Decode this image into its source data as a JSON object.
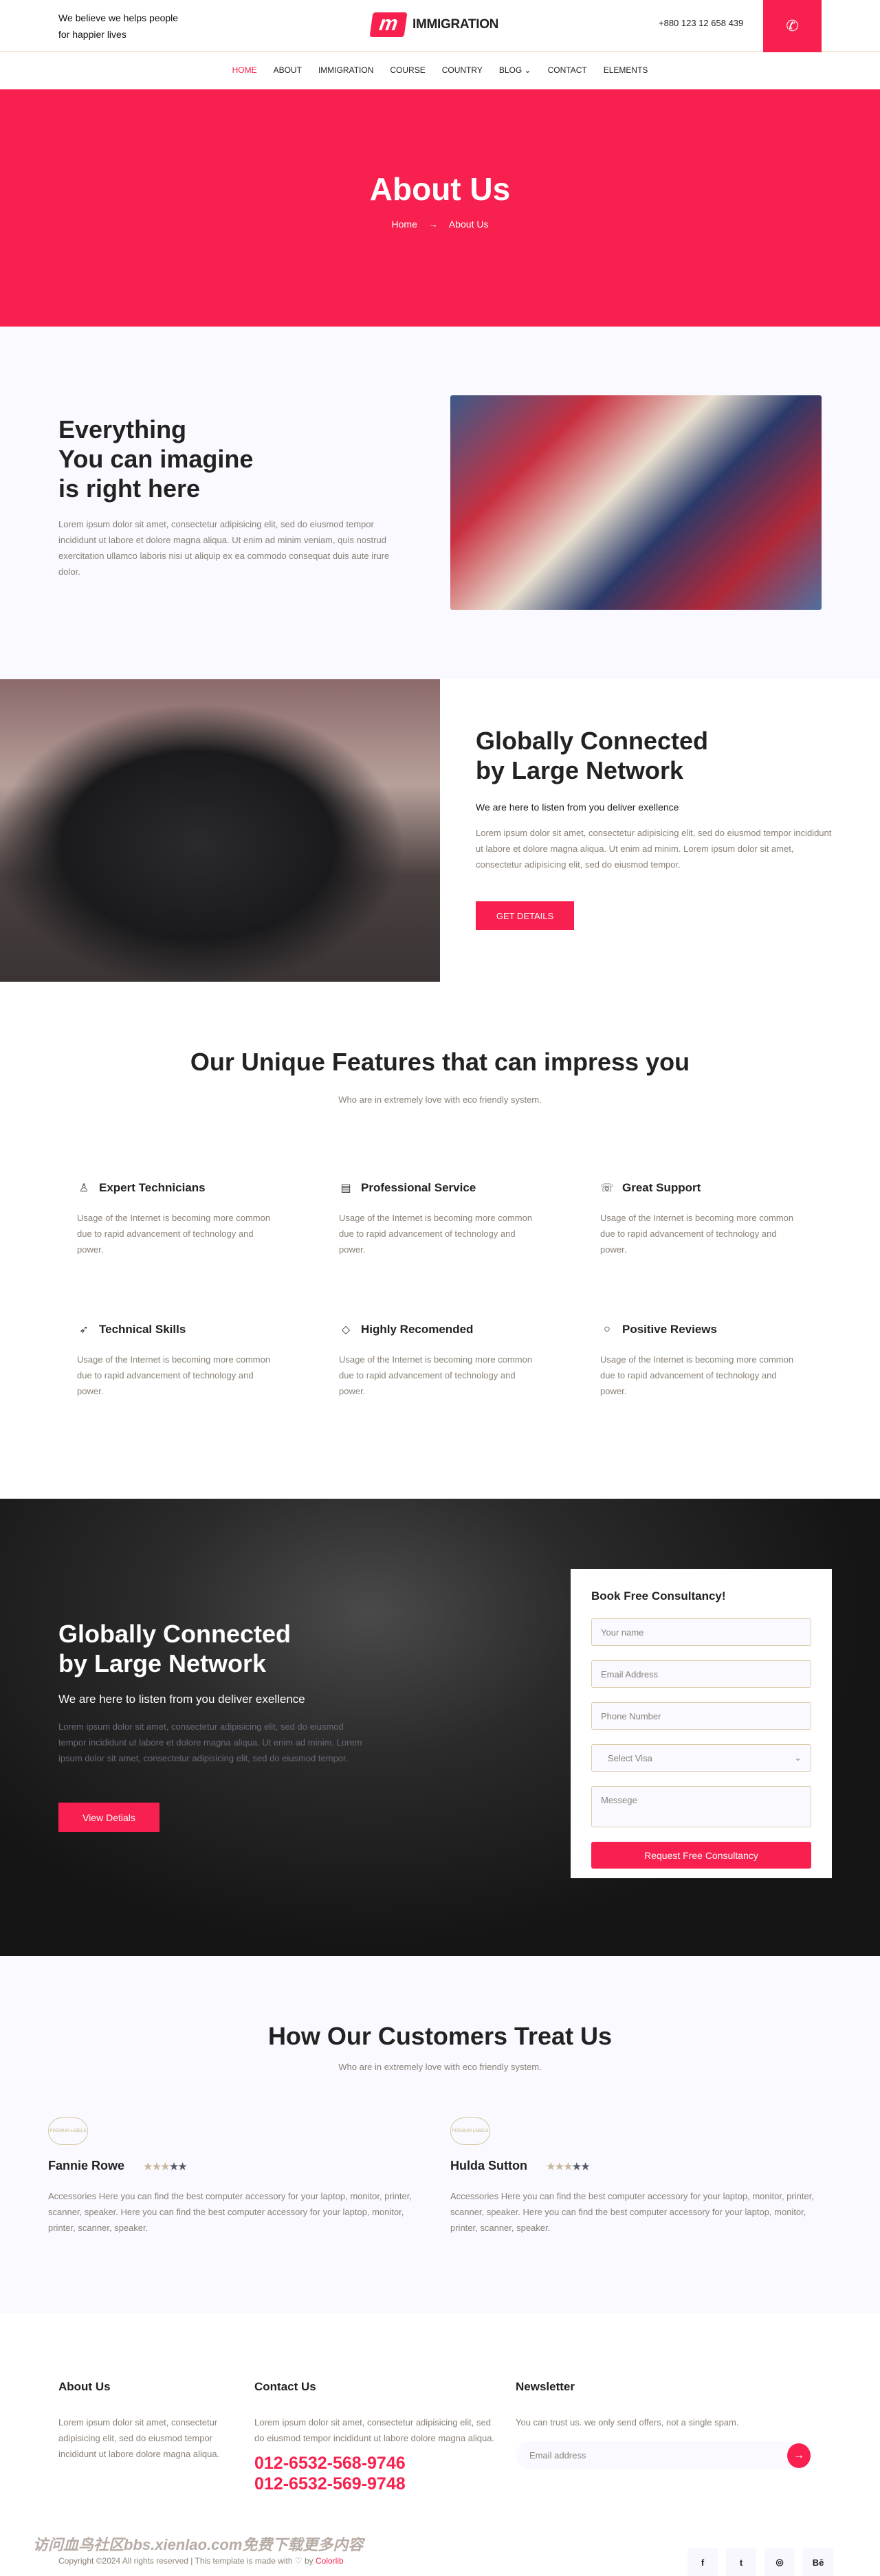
{
  "colors": {
    "accent": "#f8204e",
    "light_bg": "#f9f9ff",
    "dark_bg": "#141414"
  },
  "header": {
    "tagline_1": "We believe we helps people",
    "tagline_2": "for happier lives",
    "logo_mark": "m",
    "logo_text": "IMMIGRATION",
    "phone": "+880 123 12 658 439",
    "phone_icon": "phone-icon"
  },
  "nav": {
    "items": [
      {
        "label": "HOME",
        "active": true
      },
      {
        "label": "ABOUT"
      },
      {
        "label": "IMMIGRATION"
      },
      {
        "label": "COURSE"
      },
      {
        "label": "COUNTRY"
      },
      {
        "label": "BLOG",
        "dropdown": true
      },
      {
        "label": "CONTACT"
      },
      {
        "label": "ELEMENTS"
      }
    ],
    "dropdown_glyph": "⌄"
  },
  "hero": {
    "title": "About Us",
    "breadcrumb_home": "Home",
    "breadcrumb_arrow": "→",
    "breadcrumb_current": "About Us"
  },
  "intro": {
    "line1": "Everything",
    "line2": "You can imagine",
    "line3": "is right here",
    "text": "Lorem ipsum dolor sit amet, consectetur adipisicing elit, sed do eiusmod tempor incididunt ut labore et dolore magna aliqua. Ut enim ad minim veniam, quis nostrud exercitation ullamco laboris nisi ut aliquip ex ea commodo consequat duis aute irure dolor."
  },
  "network": {
    "line1": "Globally Connected",
    "line2": "by Large Network",
    "subtitle": "We are here to listen from you deliver exellence",
    "text": "Lorem ipsum dolor sit amet, consectetur adipisicing elit, sed do eiusmod tempor incididunt ut labore et dolore magna aliqua. Ut enim ad minim. Lorem ipsum dolor sit amet, consectetur adipisicing elit, sed do eiusmod tempor.",
    "button": "GET DETAILS"
  },
  "features": {
    "title": "Our Unique Features that can impress you",
    "subtitle": "Who are in extremely love with eco friendly system.",
    "items": [
      {
        "icon": "user-icon",
        "glyph": "♙",
        "title": "Expert Technicians",
        "text": "Usage of the Internet is becoming more common due to rapid advancement of technology and power."
      },
      {
        "icon": "license-icon",
        "glyph": "▤",
        "title": "Professional Service",
        "text": "Usage of the Internet is becoming more common due to rapid advancement of technology and power."
      },
      {
        "icon": "telephone-icon",
        "glyph": "☏",
        "title": "Great Support",
        "text": "Usage of the Internet is becoming more common due to rapid advancement of technology and power."
      },
      {
        "icon": "rocket-icon",
        "glyph": "➶",
        "title": "Technical Skills",
        "text": "Usage of the Internet is becoming more common due to rapid advancement of technology and power."
      },
      {
        "icon": "diamond-icon",
        "glyph": "◇",
        "title": "Highly Recomended",
        "text": "Usage of the Internet is becoming more common due to rapid advancement of technology and power."
      },
      {
        "icon": "bubble-icon",
        "glyph": "○",
        "title": "Positive Reviews",
        "text": "Usage of the Internet is becoming more common due to rapid advancement of technology and power."
      }
    ]
  },
  "consult": {
    "line1": "Globally Connected",
    "line2": "by Large Network",
    "subtitle": "We are here to listen from you deliver exellence",
    "text": "Lorem ipsum dolor sit amet, consectetur adipisicing elit, sed do eiusmod tempor incididunt ut labore et dolore magna aliqua. Ut enim ad minim. Lorem ipsum dolor sit amet, consectetur adipisicing elit, sed do eiusmod tempor.",
    "button": "View Detials",
    "form": {
      "title": "Book Free Consultancy!",
      "name_placeholder": "Your name",
      "email_placeholder": "Email Address",
      "phone_placeholder": "Phone Number",
      "visa_selected": "Select Visa",
      "message_placeholder": "Messege",
      "submit": "Request Free Consultancy"
    }
  },
  "testimonials": {
    "title": "How Our Customers Treat Us",
    "subtitle": "Who are in extremely love with eco friendly system.",
    "badge_text": "PREMIUM LABELS",
    "items": [
      {
        "name": "Fannie Rowe",
        "rating": 3,
        "max": 5,
        "text": "Accessories Here you can find the best computer accessory for your laptop, monitor, printer, scanner, speaker. Here you can find the best computer accessory for your laptop, monitor, printer, scanner, speaker."
      },
      {
        "name": "Hulda Sutton",
        "rating": 3,
        "max": 5,
        "text": "Accessories Here you can find the best computer accessory for your laptop, monitor, printer, scanner, speaker. Here you can find the best computer accessory for your laptop, monitor, printer, scanner, speaker."
      }
    ]
  },
  "footer": {
    "about_title": "About Us",
    "about_text": "Lorem ipsum dolor sit amet, consectetur adipisicing elit, sed do eiusmod tempor incididunt ut labore dolore magna aliqua.",
    "contact_title": "Contact Us",
    "contact_text": "Lorem ipsum dolor sit amet, consectetur adipisicing elit, sed do eiusmod tempor incididunt ut labore dolore magna aliqua.",
    "phone1": "012-6532-568-9746",
    "phone2": "012-6532-569-9748",
    "newsletter_title": "Newsletter",
    "newsletter_text": "You can trust us. we only send offers, not a single spam.",
    "email_placeholder": "Email address",
    "submit_glyph": "→",
    "watermark": "访问血鸟社区bbs.xienlao.com免费下载更多内容",
    "copyright": "Copyright ©2024 All rights reserved | This template is made with ♡ by ",
    "copyright_link": "Colorlib",
    "social": [
      {
        "icon": "facebook-icon",
        "glyph": "f"
      },
      {
        "icon": "twitter-icon",
        "glyph": "t"
      },
      {
        "icon": "dribbble-icon",
        "glyph": "◎"
      },
      {
        "icon": "behance-icon",
        "glyph": "Bē"
      }
    ]
  }
}
